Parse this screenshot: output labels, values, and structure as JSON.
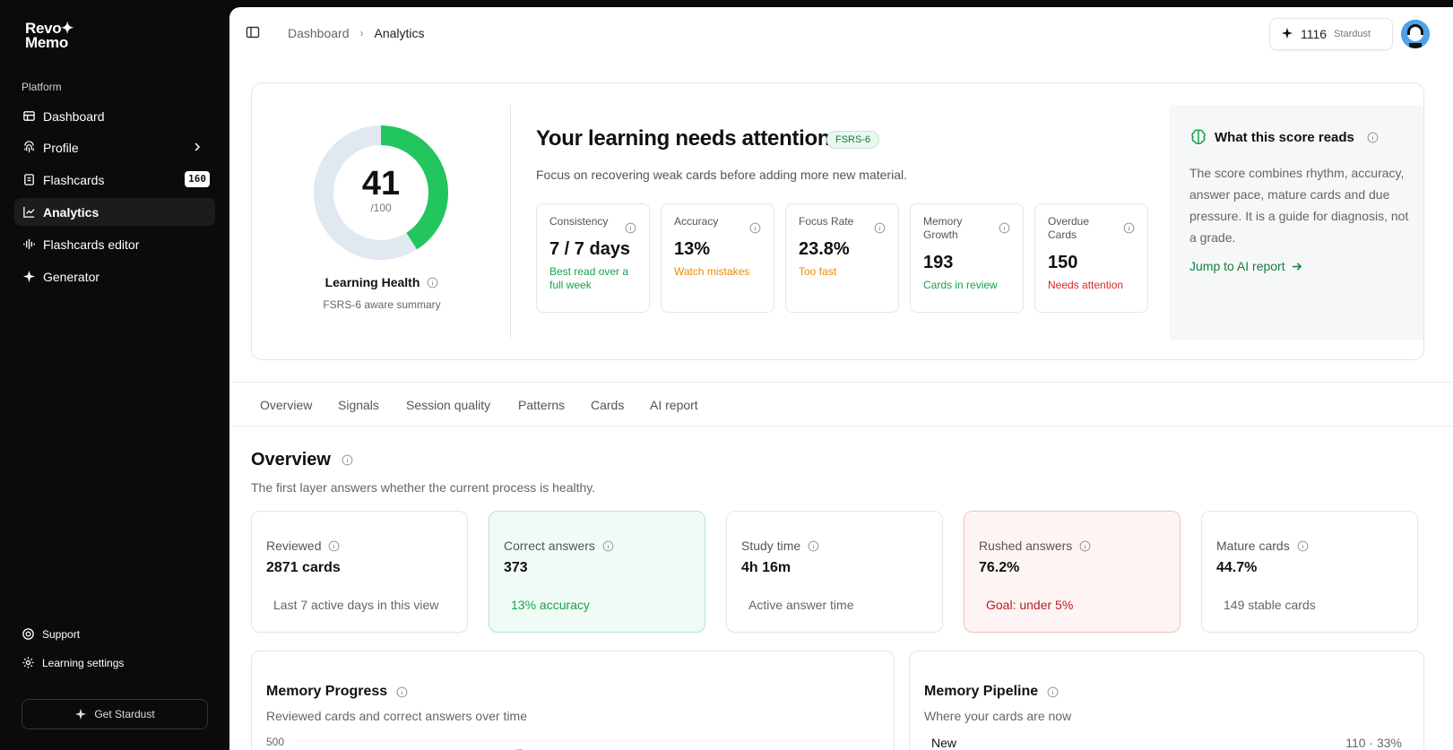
{
  "app": {
    "logo_line1": "Revo",
    "logo_line2": "Memo"
  },
  "sidebar": {
    "section_label": "Platform",
    "items": [
      {
        "label": "Dashboard",
        "icon": "dashboard-icon"
      },
      {
        "label": "Profile",
        "icon": "fingerprint-icon"
      },
      {
        "label": "Flashcards",
        "icon": "flashcards-icon",
        "badge": "160"
      },
      {
        "label": "Analytics",
        "icon": "analytics-icon",
        "active": true
      },
      {
        "label": "Flashcards editor",
        "icon": "waveform-icon"
      },
      {
        "label": "Generator",
        "icon": "sparkle-icon"
      }
    ],
    "support_label": "Support",
    "settings_label": "Learning settings",
    "get_stardust_label": "Get Stardust"
  },
  "header": {
    "breadcrumb": [
      "Dashboard",
      "Analytics"
    ],
    "stardust_count": "1116",
    "stardust_label": "Stardust"
  },
  "hero": {
    "score": "41",
    "score_max": "/100",
    "score_fraction": 0.41,
    "health_title": "Learning Health",
    "health_sub": "FSRS-6 aware summary",
    "title": "Your learning needs attention",
    "tag": "FSRS-6",
    "subtitle": "Focus on recovering weak cards before adding more new material.",
    "metrics": [
      {
        "title": "Consistency",
        "value": "7 / 7 days",
        "note": "Best read over a full week",
        "tone": "green"
      },
      {
        "title": "Accuracy",
        "value": "13%",
        "note": "Watch mistakes",
        "tone": "orange"
      },
      {
        "title": "Focus Rate",
        "value": "23.8%",
        "note": "Too fast",
        "tone": "orange"
      },
      {
        "title": "Memory Growth",
        "value": "193",
        "note": "Cards in review",
        "tone": "green"
      },
      {
        "title": "Overdue Cards",
        "value": "150",
        "note": "Needs attention",
        "tone": "red"
      }
    ],
    "explain_title": "What this score reads",
    "explain_body": "The score combines rhythm, accuracy, answer pace, mature cards and due pressure. It is a guide for diagnosis, not a grade.",
    "explain_link": "Jump to AI report"
  },
  "tabs": [
    "Overview",
    "Signals",
    "Session quality",
    "Patterns",
    "Cards",
    "AI report"
  ],
  "overview": {
    "title": "Overview",
    "subtitle": "The first layer answers whether the current process is healthy.",
    "stats": [
      {
        "title": "Reviewed",
        "value": "2871 cards",
        "note": "Last 7 active days in this view"
      },
      {
        "title": "Correct answers",
        "value": "373",
        "note": "13% accuracy"
      },
      {
        "title": "Study time",
        "value": "4h 16m",
        "note": "Active answer time"
      },
      {
        "title": "Rushed answers",
        "value": "76.2%",
        "note": "Goal: under 5%"
      },
      {
        "title": "Mature cards",
        "value": "44.7%",
        "note": "149 stable cards"
      }
    ]
  },
  "memory_progress": {
    "title": "Memory Progress",
    "subtitle": "Reviewed cards and correct answers over time",
    "y_tick": "500"
  },
  "memory_pipeline": {
    "title": "Memory Pipeline",
    "subtitle": "Where your cards are now",
    "rows": [
      {
        "label": "New",
        "value": "110 · 33%"
      }
    ]
  },
  "colors": {
    "accent_green": "#22c55e",
    "donut_track": "#e2e8f0"
  }
}
